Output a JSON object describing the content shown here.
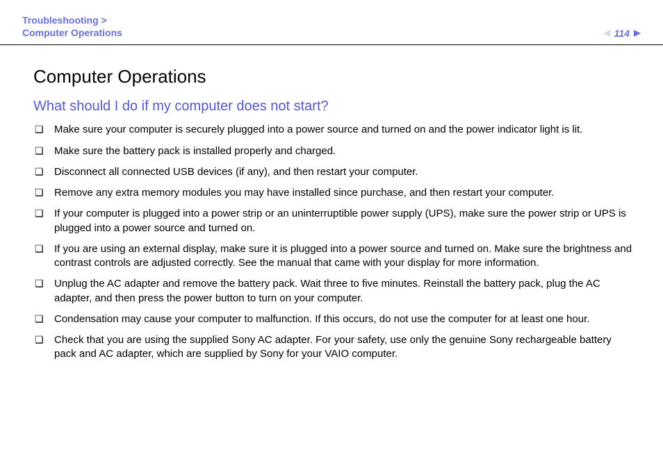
{
  "header": {
    "breadcrumb_line1": "Troubleshooting >",
    "breadcrumb_line2": "Computer Operations",
    "page_number": "114"
  },
  "main": {
    "title": "Computer Operations",
    "subtitle": "What should I do if my computer does not start?",
    "items": [
      "Make sure your computer is securely plugged into a power source and turned on and the power indicator light is lit.",
      "Make sure the battery pack is installed properly and charged.",
      "Disconnect all connected USB devices (if any), and then restart your computer.",
      "Remove any extra memory modules you may have installed since purchase, and then restart your computer.",
      "If your computer is plugged into a power strip or an uninterruptible power supply (UPS), make sure the power strip or UPS is plugged into a power source and turned on.",
      "If you are using an external display, make sure it is plugged into a power source and turned on. Make sure the brightness and contrast controls are adjusted correctly. See the manual that came with your display for more information.",
      "Unplug the AC adapter and remove the battery pack. Wait three to five minutes. Reinstall the battery pack, plug the AC adapter, and then press the power button to turn on your computer.",
      "Condensation may cause your computer to malfunction. If this occurs, do not use the computer for at least one hour.",
      "Check that you are using the supplied Sony AC adapter. For your safety, use only the genuine Sony rechargeable battery pack and AC adapter, which are supplied by Sony for your VAIO computer."
    ]
  }
}
